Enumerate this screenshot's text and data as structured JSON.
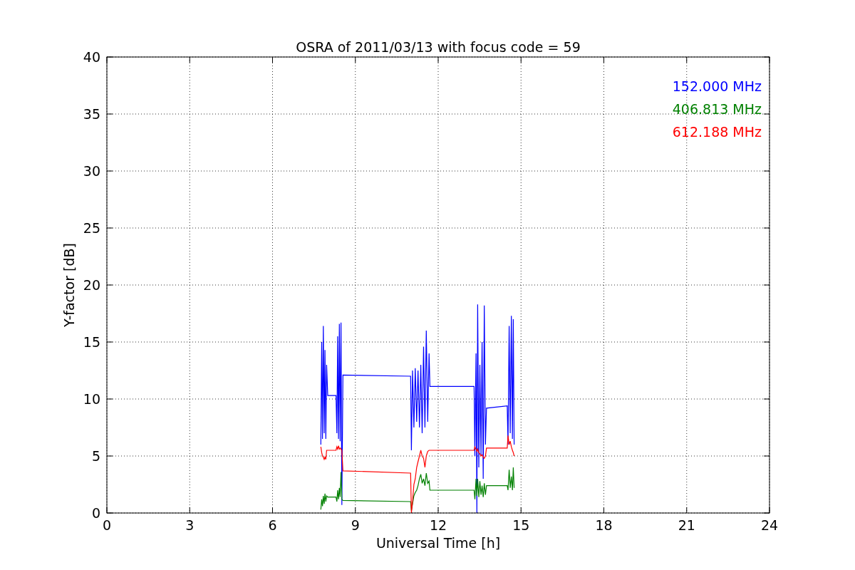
{
  "chart_data": {
    "type": "line",
    "title": "OSRA of 2011/03/13 with focus code = 59",
    "xlabel": "Universal Time [h]",
    "ylabel": "Y-factor [dB]",
    "xlim": [
      0,
      24
    ],
    "ylim": [
      0,
      40
    ],
    "xticks": [
      0,
      3,
      6,
      9,
      12,
      15,
      18,
      21,
      24
    ],
    "yticks": [
      0,
      5,
      10,
      15,
      20,
      25,
      30,
      35,
      40
    ],
    "grid": true,
    "x": [
      7.75,
      7.78,
      7.81,
      7.84,
      7.87,
      7.9,
      7.93,
      7.96,
      8.0,
      8.3,
      8.33,
      8.36,
      8.39,
      8.42,
      8.45,
      8.48,
      8.51,
      8.55,
      11.0,
      11.03,
      11.07,
      11.12,
      11.17,
      11.22,
      11.27,
      11.32,
      11.37,
      11.42,
      11.47,
      11.52,
      11.57,
      11.62,
      11.67,
      11.7,
      13.3,
      13.33,
      13.37,
      13.4,
      13.43,
      13.47,
      13.51,
      13.55,
      13.59,
      13.63,
      13.67,
      13.71,
      13.75,
      14.5,
      14.53,
      14.57,
      14.61,
      14.65,
      14.69,
      14.72,
      14.75
    ],
    "series": [
      {
        "name": "152.000 MHz",
        "color": "#0000ff",
        "values": [
          6,
          15,
          6.5,
          16.4,
          7,
          14.3,
          6.5,
          13,
          10.3,
          10.3,
          7,
          15.5,
          6.5,
          16.6,
          6.3,
          16.7,
          0.7,
          12.1,
          12,
          5.5,
          12.5,
          7.5,
          12.7,
          8,
          12.5,
          7.5,
          13,
          7,
          14.6,
          7.5,
          16,
          8,
          14,
          11.1,
          11.1,
          5,
          14,
          0,
          18.3,
          4,
          13,
          5,
          15,
          3,
          18.2,
          6,
          9.2,
          9.4,
          6,
          16.4,
          7,
          17.3,
          6.5,
          17,
          6
        ]
      },
      {
        "name": "406.813 MHz",
        "color": "#008000",
        "values": [
          0.3,
          1.2,
          0.6,
          1.5,
          0.8,
          1.7,
          1,
          1.5,
          1.4,
          1.4,
          1,
          2,
          1.2,
          2.2,
          1.4,
          3.6,
          1.2,
          1.1,
          1,
          0.2,
          0.8,
          1.5,
          1.8,
          2,
          2.4,
          3,
          3.4,
          2.6,
          3,
          2.4,
          3.5,
          2.6,
          2.8,
          2,
          2,
          1.2,
          3,
          1.5,
          3,
          1.4,
          2.8,
          1.6,
          2.4,
          1.4,
          2.6,
          1.6,
          2.4,
          2.4,
          2,
          3.8,
          2.2,
          3.2,
          2,
          4,
          2.2
        ]
      },
      {
        "name": "612.188 MHz",
        "color": "#ff0000",
        "values": [
          5.8,
          5.3,
          5,
          4.9,
          4.7,
          4.9,
          4.7,
          5.5,
          5.5,
          5.5,
          5.8,
          5.6,
          5.9,
          5.6,
          5.7,
          5.6,
          5.5,
          3.7,
          3.5,
          0,
          1,
          2.5,
          3,
          4,
          4.5,
          5,
          5.5,
          5,
          4.8,
          4,
          5,
          5.4,
          5.5,
          5.5,
          5.5,
          5.8,
          5.6,
          5.4,
          5.6,
          5.3,
          5.2,
          5,
          5.1,
          4.9,
          4.8,
          5,
          5.7,
          5.7,
          6.8,
          6,
          6.3,
          5.8,
          5.5,
          5.3,
          5
        ]
      }
    ]
  }
}
